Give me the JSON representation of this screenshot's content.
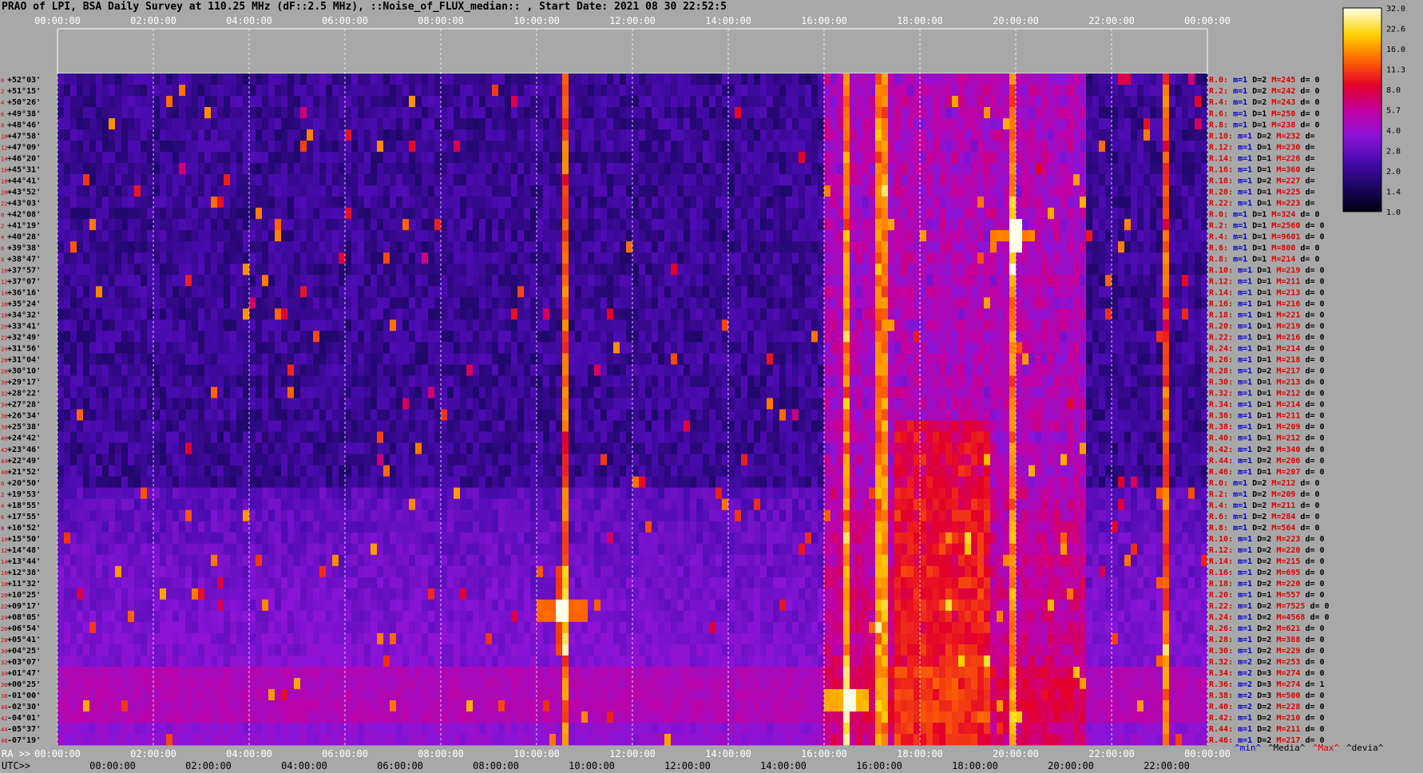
{
  "chart_data": {
    "type": "heatmap",
    "title": "PRAO of LPI, BSA Daily Survey at 110.25 MHz (dF::2.5 MHz), ::Noise_of_FLUX_median:: , Start Date: 2021 08 30 22:52:5",
    "top_time_ticks": [
      "00:00:00",
      "02:00:00",
      "04:00:00",
      "06:00:00",
      "08:00:00",
      "10:00:00",
      "12:00:00",
      "14:00:00",
      "16:00:00",
      "18:00:00",
      "20:00:00",
      "22:00:00",
      "00:00:00"
    ],
    "ra_label": "RA >>",
    "ra_ticks": [
      "00:00:00",
      "02:00:00",
      "04:00:00",
      "06:00:00",
      "08:00:00",
      "10:00:00",
      "12:00:00",
      "14:00:00",
      "16:00:00",
      "18:00:00",
      "20:00:00",
      "22:00:00",
      "00:00:00"
    ],
    "utc_label": "UTC>>",
    "utc_ticks": [
      "00:00:00",
      "02:00:00",
      "04:00:00",
      "06:00:00",
      "08:00:00",
      "10:00:00",
      "12:00:00",
      "14:00:00",
      "16:00:00",
      "18:00:00",
      "20:00:00",
      "22:00:00"
    ],
    "declinations": [
      "+52°03'",
      "+51°15'",
      "+50°26'",
      "+49°38'",
      "+48°46'",
      "+47°58'",
      "+47°09'",
      "+46°20'",
      "+45°31'",
      "+44°41'",
      "+43°52'",
      "+43°03'",
      "+42°08'",
      "+41°19'",
      "+40°28'",
      "+39°38'",
      "+38°47'",
      "+37°57'",
      "+37°07'",
      "+36°16'",
      "+35°24'",
      "+34°32'",
      "+33°41'",
      "+32°49'",
      "+31°56'",
      "+31°04'",
      "+30°10'",
      "+29°17'",
      "+28°22'",
      "+27°28'",
      "+26°34'",
      "+25°38'",
      "+24°42'",
      "+23°46'",
      "+22°49'",
      "+21°52'",
      "+20°50'",
      "+19°53'",
      "+18°55'",
      "+17°55'",
      "+16°52'",
      "+15°50'",
      "+14°48'",
      "+13°44'",
      "+12°38'",
      "+11°32'",
      "+10°25'",
      "+09°17'",
      "+08°05'",
      "+06°54'",
      "+05°41'",
      "+04°25'",
      "+03°07'",
      "+01°47'",
      "+00°25'",
      "-01°00'",
      "-02°30'",
      "-04°01'",
      "-05°37'",
      "-07°19'"
    ],
    "beam_index_labels": [
      "0",
      "2",
      "4",
      "6",
      "8",
      "10",
      "12",
      "14",
      "16",
      "18",
      "20",
      "22",
      "0",
      "2",
      "4",
      "6",
      "8",
      "10",
      "12",
      "14",
      "16",
      "18",
      "20",
      "22",
      "24",
      "26",
      "28",
      "30",
      "32",
      "34",
      "36",
      "38",
      "40",
      "42",
      "44",
      "46",
      "0",
      "2",
      "4",
      "6",
      "8",
      "10",
      "12",
      "14",
      "16",
      "18",
      "20",
      "22",
      "24",
      "26",
      "28",
      "30",
      "32",
      "34",
      "36",
      "38",
      "40",
      "42",
      "44",
      "46"
    ],
    "row_stats": [
      {
        "r": "R.0:",
        "m": "m=1",
        "D": "D=2",
        "M": "M=245",
        "d": "d= 0"
      },
      {
        "r": "R.2:",
        "m": "m=1",
        "D": "D=2",
        "M": "M=242",
        "d": "d= 0"
      },
      {
        "r": "R.4:",
        "m": "m=1",
        "D": "D=2",
        "M": "M=243",
        "d": "d= 0"
      },
      {
        "r": "R.6:",
        "m": "m=1",
        "D": "D=1",
        "M": "M=250",
        "d": "d= 0"
      },
      {
        "r": "R.8:",
        "m": "m=1",
        "D": "D=1",
        "M": "M=238",
        "d": "d= 0"
      },
      {
        "r": "R.10:",
        "m": "m=1",
        "D": "D=2",
        "M": "M=232",
        "d": "d="
      },
      {
        "r": "R.12:",
        "m": "m=1",
        "D": "D=1",
        "M": "M=230",
        "d": "d="
      },
      {
        "r": "R.14:",
        "m": "m=1",
        "D": "D=1",
        "M": "M=226",
        "d": "d="
      },
      {
        "r": "R.16:",
        "m": "m=1",
        "D": "D=1",
        "M": "M=360",
        "d": "d="
      },
      {
        "r": "R.18:",
        "m": "m=1",
        "D": "D=2",
        "M": "M=227",
        "d": "d="
      },
      {
        "r": "R.20:",
        "m": "m=1",
        "D": "D=1",
        "M": "M=225",
        "d": "d="
      },
      {
        "r": "R.22:",
        "m": "m=1",
        "D": "D=1",
        "M": "M=223",
        "d": "d="
      },
      {
        "r": "R.0:",
        "m": "m=1",
        "D": "D=1",
        "M": "M=324",
        "d": "d= 0"
      },
      {
        "r": "R.2:",
        "m": "m=1",
        "D": "D=1",
        "M": "M=2560",
        "d": "d= 0"
      },
      {
        "r": "R.4:",
        "m": "m=1",
        "D": "D=1",
        "M": "M=9601",
        "d": "d= 0"
      },
      {
        "r": "R.6:",
        "m": "m=1",
        "D": "D=1",
        "M": "M=800",
        "d": "d= 0"
      },
      {
        "r": "R.8:",
        "m": "m=1",
        "D": "D=1",
        "M": "M=214",
        "d": "d= 0"
      },
      {
        "r": "R.10:",
        "m": "m=1",
        "D": "D=1",
        "M": "M=219",
        "d": "d= 0"
      },
      {
        "r": "R.12:",
        "m": "m=1",
        "D": "D=1",
        "M": "M=211",
        "d": "d= 0"
      },
      {
        "r": "R.14:",
        "m": "m=1",
        "D": "D=1",
        "M": "M=213",
        "d": "d= 0"
      },
      {
        "r": "R.16:",
        "m": "m=1",
        "D": "D=1",
        "M": "M=216",
        "d": "d= 0"
      },
      {
        "r": "R.18:",
        "m": "m=1",
        "D": "D=1",
        "M": "M=221",
        "d": "d= 0"
      },
      {
        "r": "R.20:",
        "m": "m=1",
        "D": "D=1",
        "M": "M=219",
        "d": "d= 0"
      },
      {
        "r": "R.22:",
        "m": "m=1",
        "D": "D=1",
        "M": "M=216",
        "d": "d= 0"
      },
      {
        "r": "R.24:",
        "m": "m=1",
        "D": "D=1",
        "M": "M=214",
        "d": "d= 0"
      },
      {
        "r": "R.26:",
        "m": "m=1",
        "D": "D=1",
        "M": "M=218",
        "d": "d= 0"
      },
      {
        "r": "R.28:",
        "m": "m=1",
        "D": "D=2",
        "M": "M=217",
        "d": "d= 0"
      },
      {
        "r": "R.30:",
        "m": "m=1",
        "D": "D=1",
        "M": "M=213",
        "d": "d= 0"
      },
      {
        "r": "R.32:",
        "m": "m=1",
        "D": "D=1",
        "M": "M=212",
        "d": "d= 0"
      },
      {
        "r": "R.34:",
        "m": "m=1",
        "D": "D=1",
        "M": "M=214",
        "d": "d= 0"
      },
      {
        "r": "R.36:",
        "m": "m=1",
        "D": "D=1",
        "M": "M=211",
        "d": "d= 0"
      },
      {
        "r": "R.38:",
        "m": "m=1",
        "D": "D=1",
        "M": "M=209",
        "d": "d= 0"
      },
      {
        "r": "R.40:",
        "m": "m=1",
        "D": "D=1",
        "M": "M=212",
        "d": "d= 0"
      },
      {
        "r": "R.42:",
        "m": "m=1",
        "D": "D=2",
        "M": "M=340",
        "d": "d= 0"
      },
      {
        "r": "R.44:",
        "m": "m=1",
        "D": "D=2",
        "M": "M=206",
        "d": "d= 0"
      },
      {
        "r": "R.46:",
        "m": "m=1",
        "D": "D=1",
        "M": "M=207",
        "d": "d= 0"
      },
      {
        "r": "R.0:",
        "m": "m=1",
        "D": "D=2",
        "M": "M=212",
        "d": "d= 0"
      },
      {
        "r": "R.2:",
        "m": "m=1",
        "D": "D=2",
        "M": "M=209",
        "d": "d= 0"
      },
      {
        "r": "R.4:",
        "m": "m=1",
        "D": "D=2",
        "M": "M=211",
        "d": "d= 0"
      },
      {
        "r": "R.6:",
        "m": "m=1",
        "D": "D=2",
        "M": "M=284",
        "d": "d= 0"
      },
      {
        "r": "R.8:",
        "m": "m=1",
        "D": "D=2",
        "M": "M=564",
        "d": "d= 0"
      },
      {
        "r": "R.10:",
        "m": "m=1",
        "D": "D=2",
        "M": "M=223",
        "d": "d= 0"
      },
      {
        "r": "R.12:",
        "m": "m=1",
        "D": "D=2",
        "M": "M=220",
        "d": "d= 0"
      },
      {
        "r": "R.14:",
        "m": "m=1",
        "D": "D=2",
        "M": "M=215",
        "d": "d= 0"
      },
      {
        "r": "R.16:",
        "m": "m=1",
        "D": "D=2",
        "M": "M=695",
        "d": "d= 0"
      },
      {
        "r": "R.18:",
        "m": "m=1",
        "D": "D=2",
        "M": "M=220",
        "d": "d= 0"
      },
      {
        "r": "R.20:",
        "m": "m=1",
        "D": "D=1",
        "M": "M=557",
        "d": "d= 0"
      },
      {
        "r": "R.22:",
        "m": "m=1",
        "D": "D=2",
        "M": "M=7525",
        "d": "d= 0"
      },
      {
        "r": "R.24:",
        "m": "m=1",
        "D": "D=2",
        "M": "M=4568",
        "d": "d= 0"
      },
      {
        "r": "R.26:",
        "m": "m=1",
        "D": "D=2",
        "M": "M=621",
        "d": "d= 0"
      },
      {
        "r": "R.28:",
        "m": "m=1",
        "D": "D=2",
        "M": "M=388",
        "d": "d= 0"
      },
      {
        "r": "R.30:",
        "m": "m=1",
        "D": "D=2",
        "M": "M=229",
        "d": "d= 0"
      },
      {
        "r": "R.32:",
        "m": "m=2",
        "D": "D=2",
        "M": "M=253",
        "d": "d= 0"
      },
      {
        "r": "R.34:",
        "m": "m=2",
        "D": "D=3",
        "M": "M=274",
        "d": "d= 0"
      },
      {
        "r": "R.36:",
        "m": "m=2",
        "D": "D=3",
        "M": "M=274",
        "d": "d= 1"
      },
      {
        "r": "R.38:",
        "m": "m=2",
        "D": "D=3",
        "M": "M=500",
        "d": "d= 0"
      },
      {
        "r": "R.40:",
        "m": "m=2",
        "D": "D=2",
        "M": "M=228",
        "d": "d= 0"
      },
      {
        "r": "R.42:",
        "m": "m=1",
        "D": "D=2",
        "M": "M=210",
        "d": "d= 0"
      },
      {
        "r": "R.44:",
        "m": "m=1",
        "D": "D=2",
        "M": "M=211",
        "d": "d= 0"
      },
      {
        "r": "R.46:",
        "m": "m=1",
        "D": "D=2",
        "M": "M=217",
        "d": "d= 0"
      }
    ],
    "footer_legend": [
      {
        "text": "^min^",
        "color": "#0000cc"
      },
      {
        "text": "^Media^",
        "color": "#000000"
      },
      {
        "text": "^Max^",
        "color": "#dd0000"
      },
      {
        "text": "^devia^",
        "color": "#000000"
      }
    ],
    "colorbar_ticks": [
      "32.0",
      "22.6",
      "16.0",
      "11.3",
      "8.0",
      "5.7",
      "4.0",
      "2.8",
      "2.0",
      "1.4",
      "1.0"
    ],
    "colorbar_scale": "log",
    "sources": [
      {
        "ra_hours": 10.55,
        "dec_row": 47.5,
        "peak": 32
      },
      {
        "ra_hours": 19.95,
        "dec_row": 14.0,
        "peak": 32
      },
      {
        "ra_hours": 16.5,
        "dec_row": 55.5,
        "peak": 32
      }
    ],
    "vertical_streaks_ra_hours": [
      10.55,
      19.95,
      23.1,
      17.2,
      16.5
    ],
    "colors": {
      "bg": "#a8a8a8",
      "row_label": "#dd0000",
      "stat_m": "#0000cc",
      "dec_label": "#000000"
    }
  }
}
